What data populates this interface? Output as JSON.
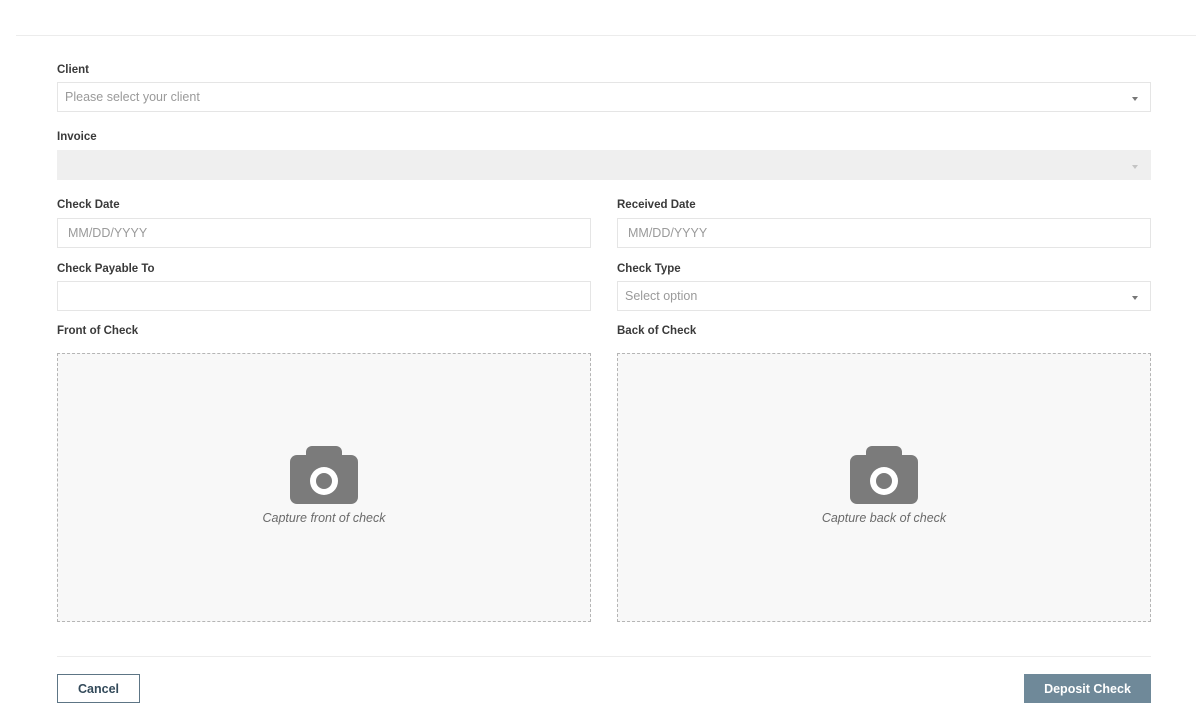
{
  "form": {
    "client": {
      "label": "Client",
      "placeholder": "Please select your client",
      "value": ""
    },
    "invoice": {
      "label": "Invoice",
      "value": "",
      "disabled": true
    },
    "check_date": {
      "label": "Check Date",
      "placeholder": "MM/DD/YYYY",
      "value": ""
    },
    "received_date": {
      "label": "Received Date",
      "placeholder": "MM/DD/YYYY",
      "value": ""
    },
    "check_payable_to": {
      "label": "Check Payable To",
      "value": ""
    },
    "check_type": {
      "label": "Check Type",
      "placeholder": "Select option",
      "value": ""
    },
    "front_of_check": {
      "label": "Front of Check",
      "prompt": "Capture front of check",
      "icon": "camera-icon"
    },
    "back_of_check": {
      "label": "Back of Check",
      "prompt": "Capture back of check",
      "icon": "camera-icon"
    }
  },
  "actions": {
    "cancel_label": "Cancel",
    "deposit_label": "Deposit Check"
  },
  "colors": {
    "primary_button": "#6f8999",
    "cancel_border": "#5d7585",
    "dropzone_bg": "#f8f8f8",
    "disabled_field": "#efefef"
  }
}
